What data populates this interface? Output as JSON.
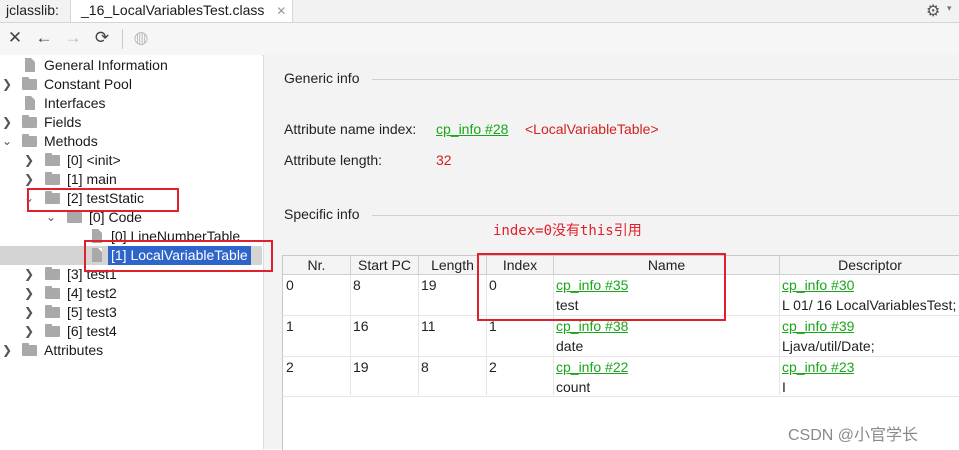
{
  "tabbar": {
    "library_label": "jclasslib:",
    "tab_label": "_16_LocalVariablesTest.class",
    "tab_close": "✕"
  },
  "toolbar": {
    "icons": [
      "close-icon",
      "back-icon",
      "forward-icon",
      "refresh-icon",
      "web-icon",
      "gear-icon"
    ]
  },
  "tree": {
    "items": [
      {
        "label": "General Information"
      },
      {
        "label": "Constant Pool"
      },
      {
        "label": "Interfaces"
      },
      {
        "label": "Fields"
      },
      {
        "label": "Methods"
      },
      {
        "label": "[0] <init>"
      },
      {
        "label": "[1] main"
      },
      {
        "label": "[2] testStatic"
      },
      {
        "label": "[0] Code"
      },
      {
        "label": "[0] LineNumberTable"
      },
      {
        "label": "[1] LocalVariableTable"
      },
      {
        "label": "[3] test1"
      },
      {
        "label": "[4] test2"
      },
      {
        "label": "[5] test3"
      },
      {
        "label": "[6] test4"
      },
      {
        "label": "Attributes"
      }
    ]
  },
  "generic_info": {
    "title": "Generic info",
    "attr_name_label": "Attribute name index:",
    "attr_name_link": "cp_info #28",
    "attr_name_value": "<LocalVariableTable>",
    "attr_length_label": "Attribute length:",
    "attr_length_value": "32"
  },
  "specific_info": {
    "title": "Specific info",
    "columns": [
      "Nr.",
      "Start PC",
      "Length",
      "Index",
      "Name",
      "Descriptor"
    ],
    "rows": [
      {
        "nr": "0",
        "start_pc": "8",
        "length": "19",
        "index": "0",
        "name_link": "cp_info #35",
        "name": "test",
        "desc_link": "cp_info #30",
        "desc": "L 01/ 16 LocalVariablesTest;"
      },
      {
        "nr": "1",
        "start_pc": "16",
        "length": "11",
        "index": "1",
        "name_link": "cp_info #38",
        "name": "date",
        "desc_link": "cp_info #39",
        "desc": "Ljava/util/Date;"
      },
      {
        "nr": "2",
        "start_pc": "19",
        "length": "8",
        "index": "2",
        "name_link": "cp_info #22",
        "name": "count",
        "desc_link": "cp_info #23",
        "desc": "I"
      }
    ]
  },
  "annotation": "index=0没有this引用",
  "watermark": "CSDN @小官学长",
  "colors": {
    "link": "#1aa61a",
    "value_red": "#d42020",
    "annotation_red": "#e0202b",
    "selection": "#2f65ca"
  }
}
